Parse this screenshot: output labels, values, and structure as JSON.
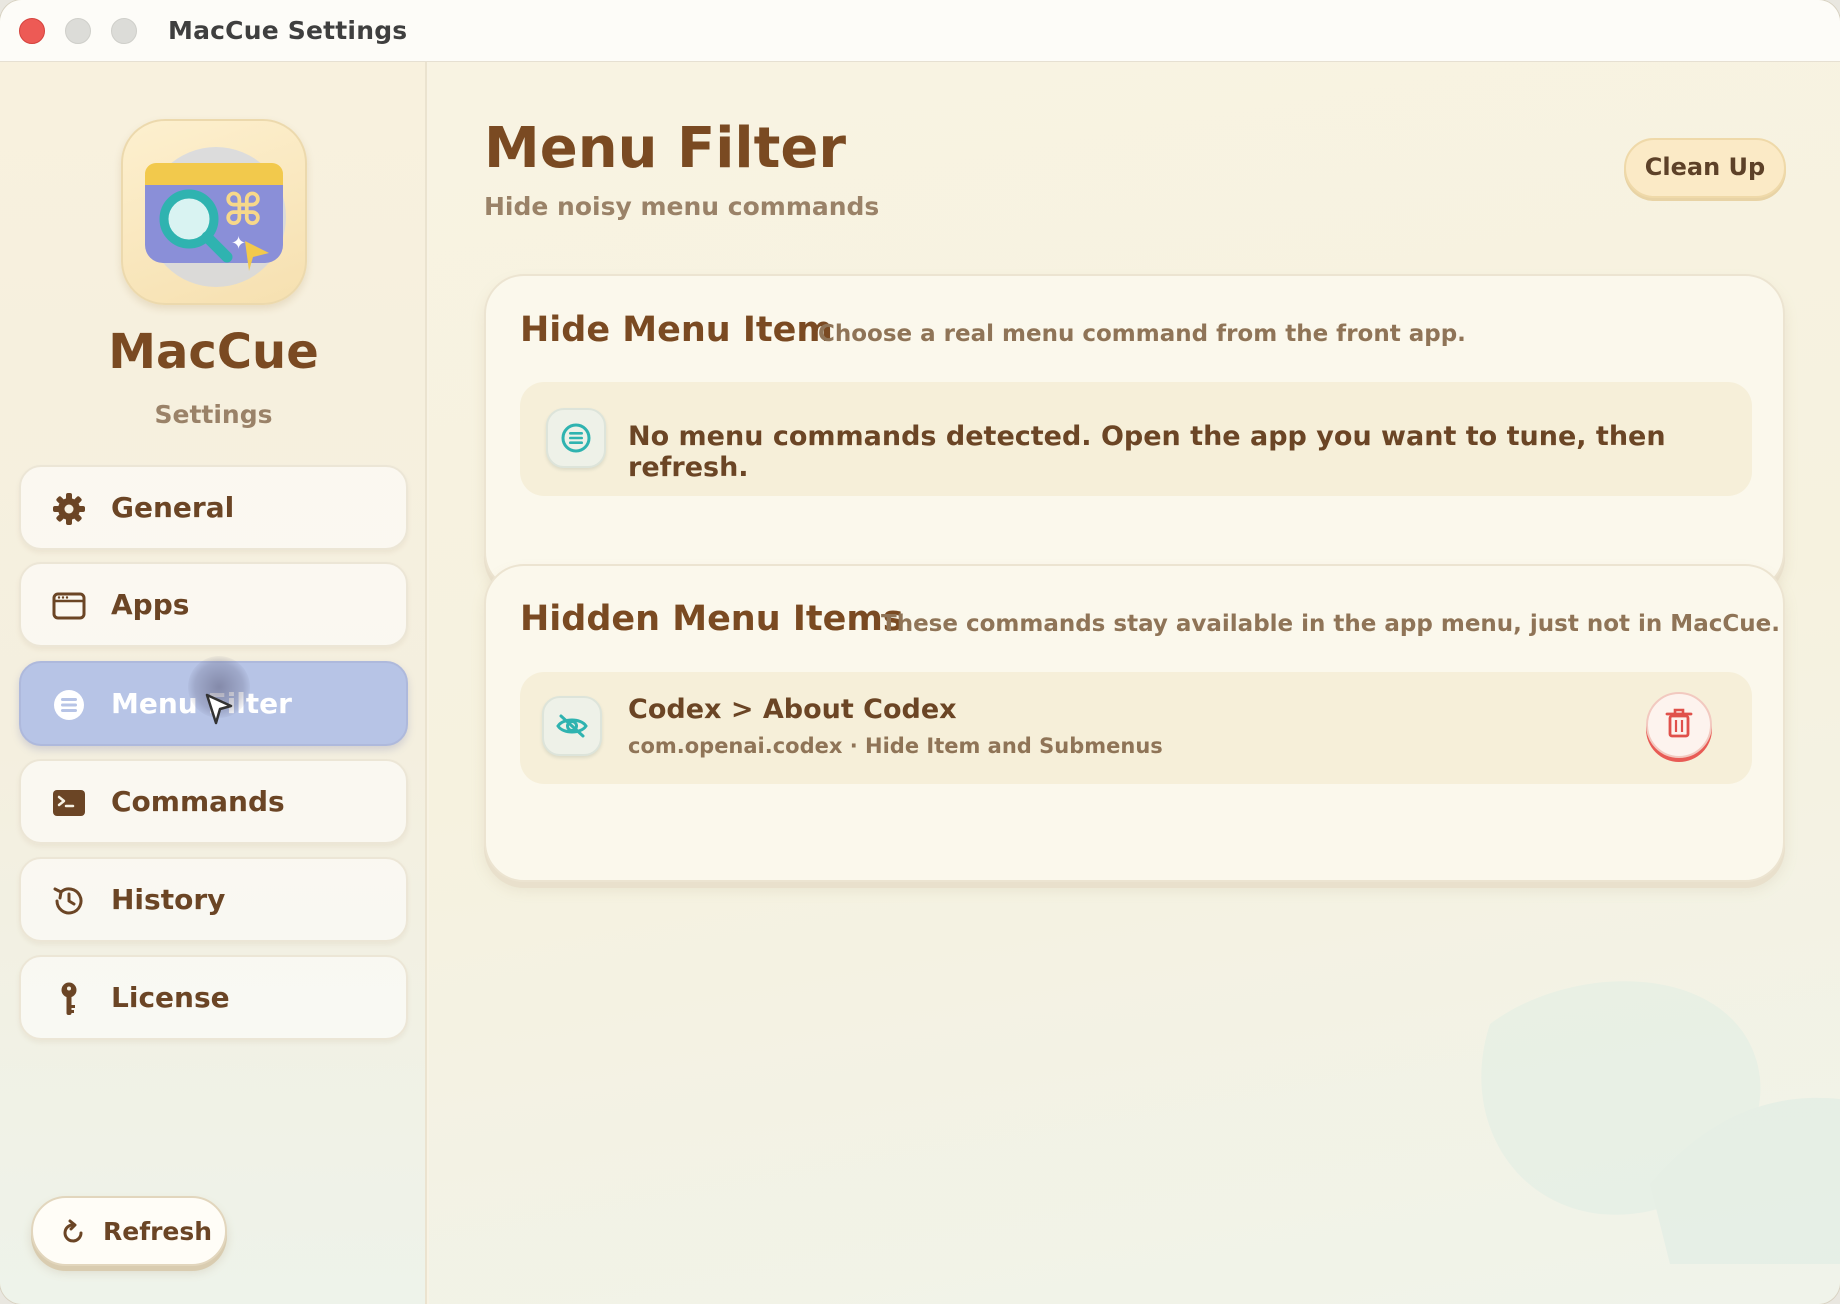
{
  "window": {
    "title": "MacCue Settings"
  },
  "sidebar": {
    "app_name": "MacCue",
    "app_subtitle": "Settings",
    "items": [
      {
        "label": "General",
        "icon": "gear-icon"
      },
      {
        "label": "Apps",
        "icon": "window-icon"
      },
      {
        "label": "Menu Filter",
        "icon": "list-circle-icon",
        "active": true
      },
      {
        "label": "Commands",
        "icon": "terminal-icon"
      },
      {
        "label": "History",
        "icon": "history-icon"
      },
      {
        "label": "License",
        "icon": "key-icon"
      }
    ],
    "refresh_label": "Refresh"
  },
  "main": {
    "title": "Menu Filter",
    "subtitle": "Hide noisy menu commands",
    "cleanup_label": "Clean Up",
    "hide_card": {
      "title": "Hide Menu Item",
      "description": "Choose a real menu command from the front app.",
      "empty_message": "No menu commands detected. Open the app you want to tune, then refresh."
    },
    "hidden_card": {
      "title": "Hidden Menu Items",
      "description": "These commands stay available in the app menu, just not in MacCue.",
      "items": [
        {
          "name": "Codex > About Codex",
          "detail": "com.openai.codex · Hide Item and Submenus"
        }
      ]
    }
  },
  "colors": {
    "accent_brown": "#7a4a22",
    "active_nav": "#b7c4e6",
    "teal_icon": "#2fb3b0",
    "danger": "#e0514b"
  }
}
